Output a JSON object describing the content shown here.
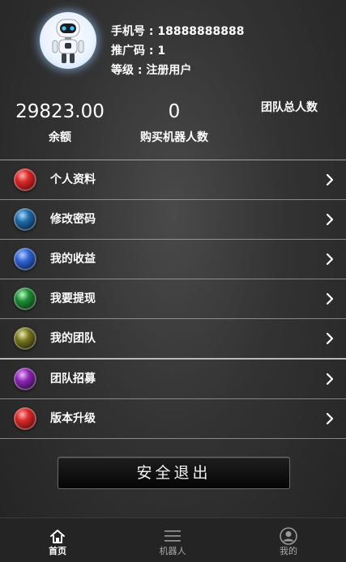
{
  "profile": {
    "phone_line": "手机号 : 18888888888",
    "promo_line": "推广码 : 1",
    "level_line": "等级 : 注册用户",
    "avatar_icon": "robot-avatar-icon"
  },
  "stats": {
    "balance_value": "29823.00",
    "balance_label": "余额",
    "robots_value": "0",
    "robots_label": "购买机器人数",
    "team_total_label": "团队总人数"
  },
  "menu": {
    "items": [
      {
        "label": "个人资料",
        "icon": "red-orb-icon",
        "color": "#c41f1f"
      },
      {
        "label": "修改密码",
        "icon": "blue-orb-icon",
        "color": "#1e5a8c"
      },
      {
        "label": "我的收益",
        "icon": "blue-orb-icon",
        "color": "#2559b8"
      },
      {
        "label": "我要提现",
        "icon": "green-orb-icon",
        "color": "#1a7a2e"
      },
      {
        "label": "我的团队",
        "icon": "olive-orb-icon",
        "color": "#6b6a1c"
      },
      {
        "label": "团队招募",
        "icon": "purple-orb-icon",
        "color": "#7a1f9a"
      },
      {
        "label": "版本升级",
        "icon": "red-orb-icon",
        "color": "#c41f1f"
      }
    ]
  },
  "logout": {
    "label": "安全退出"
  },
  "tabbar": {
    "tabs": [
      {
        "label": "首页",
        "icon": "home-icon"
      },
      {
        "label": "机器人",
        "icon": "menu-icon"
      },
      {
        "label": "我的",
        "icon": "user-icon"
      }
    ]
  }
}
